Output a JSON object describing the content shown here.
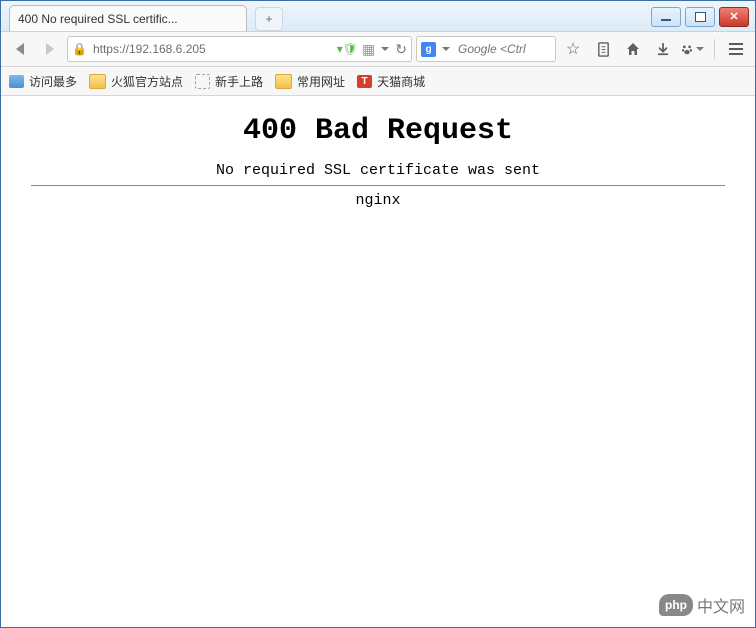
{
  "window": {
    "tab_title": "400 No required SSL certific...",
    "controls": {
      "min": "minimize",
      "max": "maximize",
      "close": "close"
    }
  },
  "nav": {
    "url": "https://192.168.6.205",
    "search_engine_label": "g",
    "search_placeholder": "Google <Ctrl"
  },
  "bookmarks": [
    {
      "label": "访问最多",
      "kind": "blue"
    },
    {
      "label": "火狐官方站点",
      "kind": "folder"
    },
    {
      "label": "新手上路",
      "kind": "dash"
    },
    {
      "label": "常用网址",
      "kind": "folder"
    },
    {
      "label": "天猫商城",
      "kind": "red",
      "badge": "T"
    }
  ],
  "page": {
    "h1": "400 Bad Request",
    "subtitle": "No required SSL certificate was sent",
    "server": "nginx"
  },
  "watermark": {
    "badge": "php",
    "text": "中文网"
  }
}
